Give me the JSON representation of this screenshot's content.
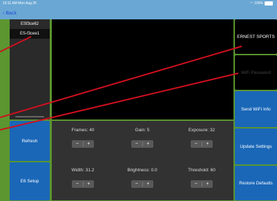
{
  "status": {
    "time": "10:11 AM  Mon Aug 26",
    "battery": "100%"
  },
  "nav": {
    "back_label": "Back"
  },
  "devices": {
    "items": [
      "ESf3ce62",
      "ES-f3cee1"
    ]
  },
  "left_buttons": {
    "refresh": "Refresh",
    "e6_setup": "E6 Setup"
  },
  "right_panel": {
    "ssid_value": "ERNEST SPORTS",
    "password_placeholder": "WiFi Password",
    "send_wifi": "Send WiFi Info",
    "update_settings": "Update Settings",
    "restore_defaults": "Restore Defaults"
  },
  "controls": {
    "frames": "Frames: 40",
    "gain": "Gain: 5",
    "exposure": "Exposure: 32",
    "width": "Width: 31.2",
    "brightness": "Brightness: 0.0",
    "threshold": "Threshold: 60",
    "minus": "−",
    "plus": "+"
  },
  "colors": {
    "accent_blue": "#1a67b8",
    "annotation_red": "#d0101f",
    "background_green": "#5b9630"
  }
}
